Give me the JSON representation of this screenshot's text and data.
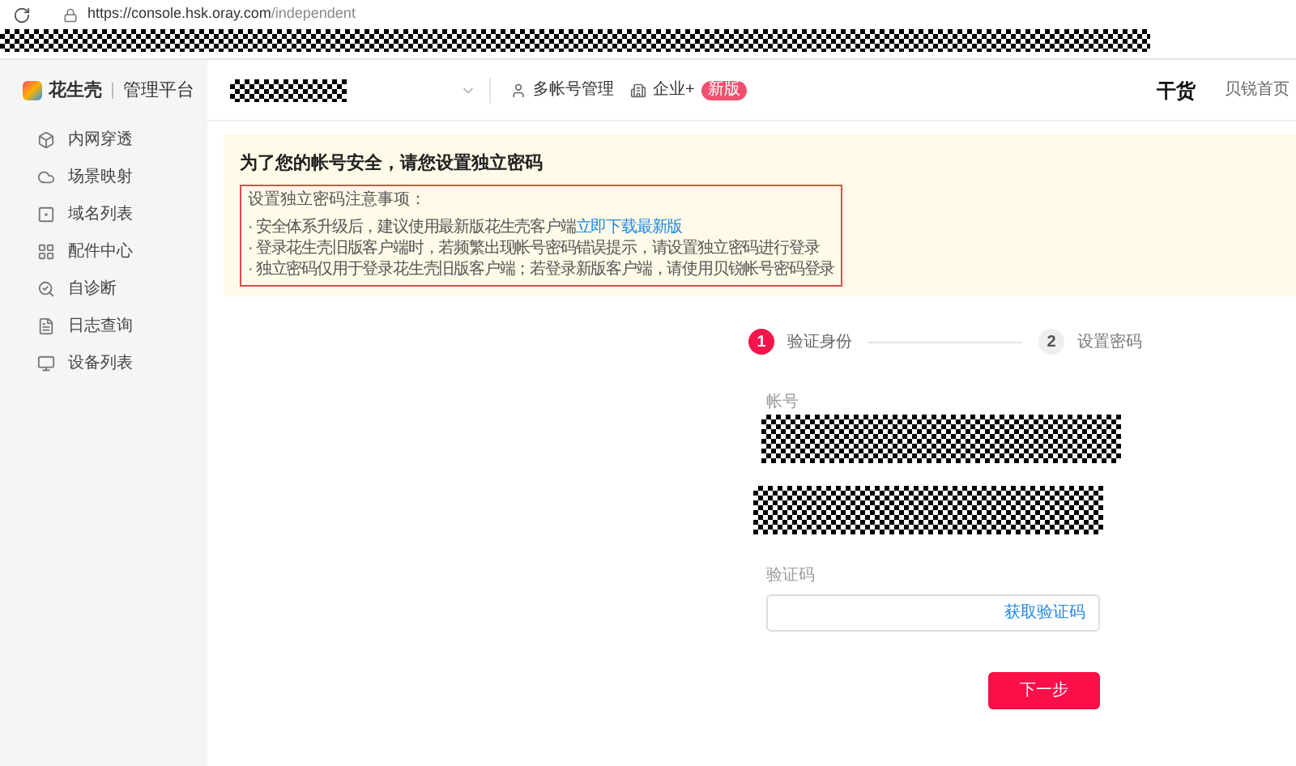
{
  "browser": {
    "url_host": "https://console.hsk.oray.com",
    "url_path": "/independent"
  },
  "brand": {
    "name": "花生壳",
    "subtitle": "管理平台"
  },
  "sidebar": {
    "items": [
      {
        "label": "内网穿透"
      },
      {
        "label": "场景映射"
      },
      {
        "label": "域名列表"
      },
      {
        "label": "配件中心"
      },
      {
        "label": "自诊断"
      },
      {
        "label": "日志查询"
      },
      {
        "label": "设备列表"
      }
    ]
  },
  "header": {
    "multi_account": "多帐号管理",
    "enterprise": "企业+",
    "badge": "新版",
    "logo": "干货",
    "home_link": "贝锐首页"
  },
  "notice": {
    "title": "为了您的帐号安全，请您设置独立密码",
    "box_title": "设置独立密码注意事项：",
    "lines": [
      {
        "text": "· 安全体系升级后，建议使用最新版花生壳客户端",
        "link": "立即下载最新版"
      },
      {
        "text": "· 登录花生壳旧版客户端时，若频繁出现帐号密码错误提示，请设置独立密码进行登录"
      },
      {
        "text": "· 独立密码仅用于登录花生壳旧版客户端；若登录新版客户端，请使用贝锐帐号密码登录"
      }
    ]
  },
  "steps": [
    {
      "number": "1",
      "label": "验证身份",
      "selected": true
    },
    {
      "number": "2",
      "label": "设置密码",
      "selected": false
    }
  ],
  "form": {
    "account_label": "帐号",
    "code_label": "验证码",
    "get_code": "获取验证码",
    "next": "下一步"
  }
}
